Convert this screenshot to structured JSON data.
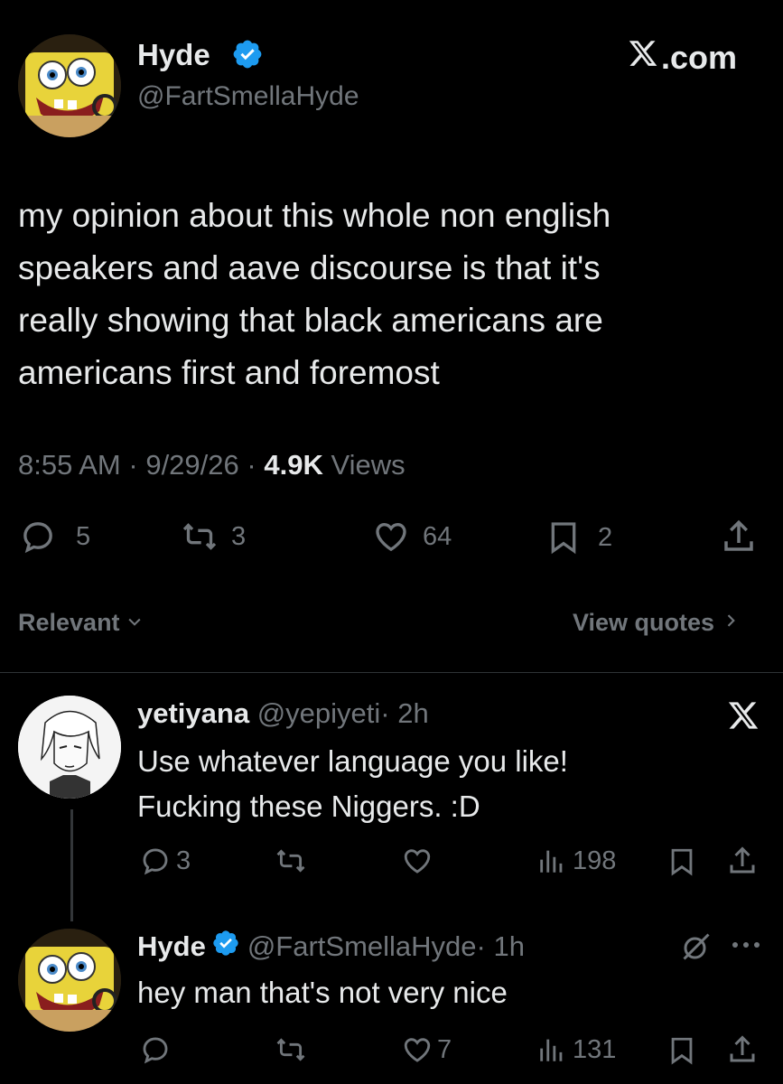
{
  "main_tweet": {
    "author_name": "Hyde",
    "handle": "@FartSmellaHyde",
    "brand": "X.com",
    "text_lines": [
      "my opinion about this whole non english",
      "speakers and aave discourse is that it's",
      "really showing that black americans are",
      "americans first and foremost"
    ],
    "time": "8:55 AM",
    "sep": "·",
    "date": "9/29/26",
    "views_count": "4.9K",
    "views_label": "Views",
    "stats": {
      "replies": "5",
      "reposts": "3",
      "likes": "64",
      "bookmarks": "2"
    }
  },
  "filter_bar": {
    "sort_label": "Relevant",
    "view_quotes": "View quotes"
  },
  "replies": [
    {
      "author_name": "yetiyana",
      "handle": "@yepiyeti",
      "time": "· 2h",
      "text_lines": [
        "Use whatever language you like!",
        "Fucking these Niggers. :D"
      ],
      "stats": {
        "replies": "3",
        "reposts": "",
        "likes": "",
        "views": "198"
      }
    },
    {
      "author_name": "Hyde",
      "handle": "@FartSmellaHyde",
      "time": "· 1h",
      "text_lines": [
        "hey man that's not very nice"
      ],
      "stats": {
        "replies": "",
        "reposts": "",
        "likes": "7",
        "views": "131"
      }
    }
  ],
  "colors": {
    "background": "#000000",
    "text": "#e7e9ea",
    "muted": "#71767b",
    "verified": "#1d9bf0",
    "divider": "#2f3336"
  },
  "icons": [
    "x-logo-icon",
    "verified-badge-icon",
    "reply-icon",
    "repost-icon",
    "like-icon",
    "bookmark-icon",
    "share-icon",
    "views-icon",
    "chevron-down-icon",
    "chevron-right-icon",
    "grok-icon",
    "more-icon"
  ]
}
